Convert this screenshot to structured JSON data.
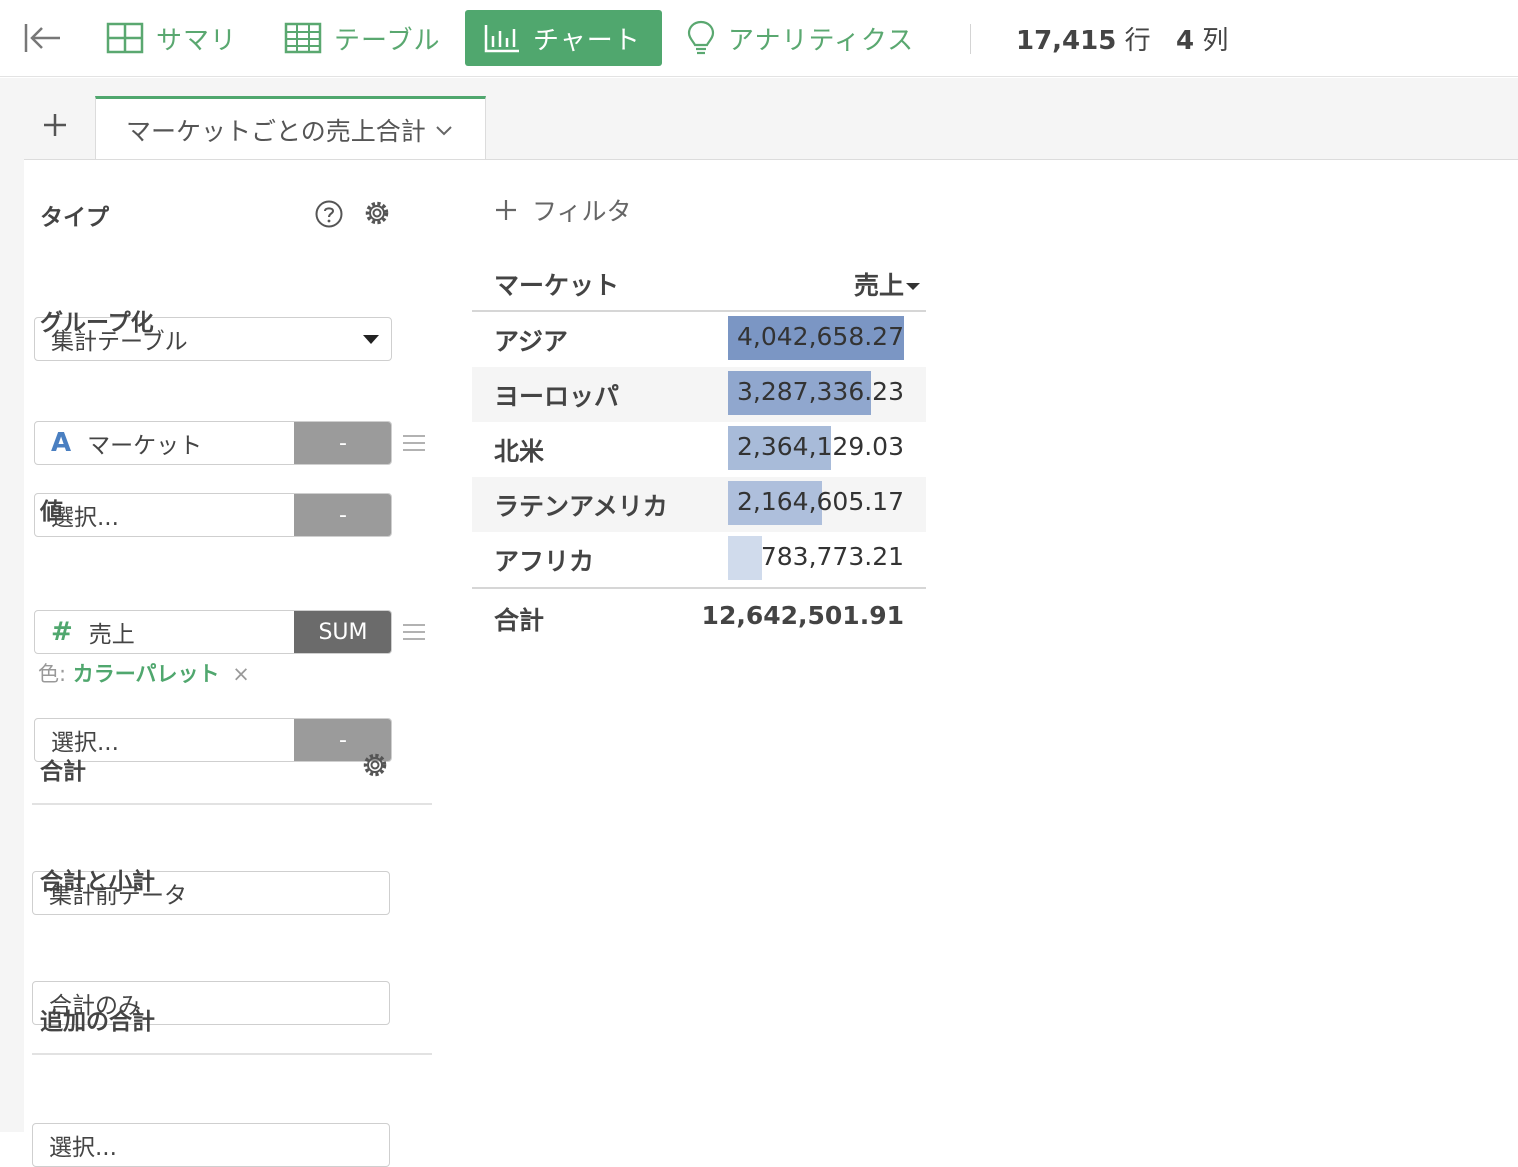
{
  "toolbar": {
    "tabs": [
      {
        "label": "サマリ",
        "icon": "grid-icon"
      },
      {
        "label": "テーブル",
        "icon": "table-icon"
      },
      {
        "label": "チャート",
        "icon": "bar-chart-icon",
        "active": true
      },
      {
        "label": "アナリティクス",
        "icon": "lightbulb-icon"
      }
    ],
    "rows_count": "17,415",
    "rows_unit": "行",
    "cols_count": "4",
    "cols_unit": "列"
  },
  "sheet": {
    "tab_title": "マーケットごとの売上合計"
  },
  "config": {
    "type_label": "タイプ",
    "type_value": "集計テーブル",
    "group_label": "グループ化",
    "group_fields": [
      {
        "badge": "A",
        "name": "マーケット",
        "agg": "-"
      },
      {
        "badge": "",
        "name": "選択...",
        "agg": "-"
      }
    ],
    "value_label": "値",
    "value_fields": [
      {
        "badge": "#",
        "name": "売上",
        "agg": "SUM"
      },
      {
        "badge": "",
        "name": "選択...",
        "agg": "-"
      }
    ],
    "color_prefix": "色:",
    "color_value": "カラーパレット",
    "color_clear": "×",
    "total_label": "合計",
    "total_value": "集計前データ",
    "subtotal_label": "合計と小計",
    "subtotal_value": "合計のみ",
    "extra_label": "追加の合計",
    "extra_value": "選択..."
  },
  "filter": {
    "label": "フィルタ"
  },
  "colors": {
    "accent": "#50a76e",
    "bar_high": "#7b96c4",
    "bar_low": "#e1e8f4"
  },
  "chart_data": {
    "type": "table",
    "columns": [
      "マーケット",
      "売上"
    ],
    "sort_column": "売上",
    "rows": [
      {
        "market": "アジア",
        "sales": 4042658.27,
        "sales_text": "4,042,658.27"
      },
      {
        "market": "ヨーロッパ",
        "sales": 3287336.23,
        "sales_text": "3,287,336.23"
      },
      {
        "market": "北米",
        "sales": 2364129.03,
        "sales_text": "2,364,129.03"
      },
      {
        "market": "ラテンアメリカ",
        "sales": 2164605.17,
        "sales_text": "2,164,605.17"
      },
      {
        "market": "アフリカ",
        "sales": 783773.21,
        "sales_text": "783,773.21"
      }
    ],
    "total_label": "合計",
    "total_text": "12,642,501.91"
  }
}
